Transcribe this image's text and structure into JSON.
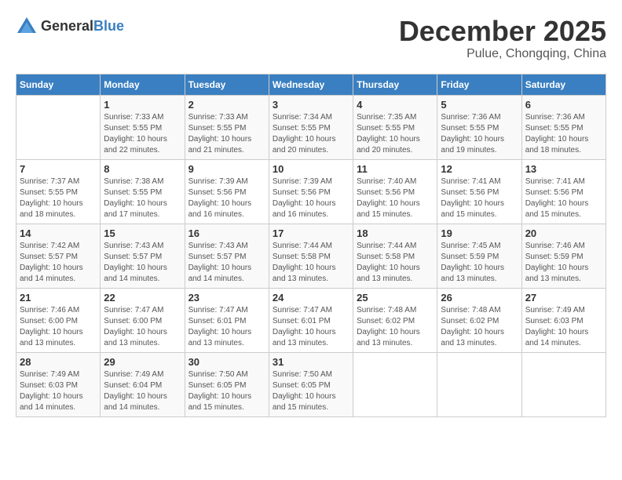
{
  "logo": {
    "general": "General",
    "blue": "Blue"
  },
  "title": "December 2025",
  "location": "Pulue, Chongqing, China",
  "days_of_week": [
    "Sunday",
    "Monday",
    "Tuesday",
    "Wednesday",
    "Thursday",
    "Friday",
    "Saturday"
  ],
  "weeks": [
    [
      {
        "day": "",
        "info": ""
      },
      {
        "day": "1",
        "info": "Sunrise: 7:33 AM\nSunset: 5:55 PM\nDaylight: 10 hours\nand 22 minutes."
      },
      {
        "day": "2",
        "info": "Sunrise: 7:33 AM\nSunset: 5:55 PM\nDaylight: 10 hours\nand 21 minutes."
      },
      {
        "day": "3",
        "info": "Sunrise: 7:34 AM\nSunset: 5:55 PM\nDaylight: 10 hours\nand 20 minutes."
      },
      {
        "day": "4",
        "info": "Sunrise: 7:35 AM\nSunset: 5:55 PM\nDaylight: 10 hours\nand 20 minutes."
      },
      {
        "day": "5",
        "info": "Sunrise: 7:36 AM\nSunset: 5:55 PM\nDaylight: 10 hours\nand 19 minutes."
      },
      {
        "day": "6",
        "info": "Sunrise: 7:36 AM\nSunset: 5:55 PM\nDaylight: 10 hours\nand 18 minutes."
      }
    ],
    [
      {
        "day": "7",
        "info": "Sunrise: 7:37 AM\nSunset: 5:55 PM\nDaylight: 10 hours\nand 18 minutes."
      },
      {
        "day": "8",
        "info": "Sunrise: 7:38 AM\nSunset: 5:55 PM\nDaylight: 10 hours\nand 17 minutes."
      },
      {
        "day": "9",
        "info": "Sunrise: 7:39 AM\nSunset: 5:56 PM\nDaylight: 10 hours\nand 16 minutes."
      },
      {
        "day": "10",
        "info": "Sunrise: 7:39 AM\nSunset: 5:56 PM\nDaylight: 10 hours\nand 16 minutes."
      },
      {
        "day": "11",
        "info": "Sunrise: 7:40 AM\nSunset: 5:56 PM\nDaylight: 10 hours\nand 15 minutes."
      },
      {
        "day": "12",
        "info": "Sunrise: 7:41 AM\nSunset: 5:56 PM\nDaylight: 10 hours\nand 15 minutes."
      },
      {
        "day": "13",
        "info": "Sunrise: 7:41 AM\nSunset: 5:56 PM\nDaylight: 10 hours\nand 15 minutes."
      }
    ],
    [
      {
        "day": "14",
        "info": "Sunrise: 7:42 AM\nSunset: 5:57 PM\nDaylight: 10 hours\nand 14 minutes."
      },
      {
        "day": "15",
        "info": "Sunrise: 7:43 AM\nSunset: 5:57 PM\nDaylight: 10 hours\nand 14 minutes."
      },
      {
        "day": "16",
        "info": "Sunrise: 7:43 AM\nSunset: 5:57 PM\nDaylight: 10 hours\nand 14 minutes."
      },
      {
        "day": "17",
        "info": "Sunrise: 7:44 AM\nSunset: 5:58 PM\nDaylight: 10 hours\nand 13 minutes."
      },
      {
        "day": "18",
        "info": "Sunrise: 7:44 AM\nSunset: 5:58 PM\nDaylight: 10 hours\nand 13 minutes."
      },
      {
        "day": "19",
        "info": "Sunrise: 7:45 AM\nSunset: 5:59 PM\nDaylight: 10 hours\nand 13 minutes."
      },
      {
        "day": "20",
        "info": "Sunrise: 7:46 AM\nSunset: 5:59 PM\nDaylight: 10 hours\nand 13 minutes."
      }
    ],
    [
      {
        "day": "21",
        "info": "Sunrise: 7:46 AM\nSunset: 6:00 PM\nDaylight: 10 hours\nand 13 minutes."
      },
      {
        "day": "22",
        "info": "Sunrise: 7:47 AM\nSunset: 6:00 PM\nDaylight: 10 hours\nand 13 minutes."
      },
      {
        "day": "23",
        "info": "Sunrise: 7:47 AM\nSunset: 6:01 PM\nDaylight: 10 hours\nand 13 minutes."
      },
      {
        "day": "24",
        "info": "Sunrise: 7:47 AM\nSunset: 6:01 PM\nDaylight: 10 hours\nand 13 minutes."
      },
      {
        "day": "25",
        "info": "Sunrise: 7:48 AM\nSunset: 6:02 PM\nDaylight: 10 hours\nand 13 minutes."
      },
      {
        "day": "26",
        "info": "Sunrise: 7:48 AM\nSunset: 6:02 PM\nDaylight: 10 hours\nand 13 minutes."
      },
      {
        "day": "27",
        "info": "Sunrise: 7:49 AM\nSunset: 6:03 PM\nDaylight: 10 hours\nand 14 minutes."
      }
    ],
    [
      {
        "day": "28",
        "info": "Sunrise: 7:49 AM\nSunset: 6:03 PM\nDaylight: 10 hours\nand 14 minutes."
      },
      {
        "day": "29",
        "info": "Sunrise: 7:49 AM\nSunset: 6:04 PM\nDaylight: 10 hours\nand 14 minutes."
      },
      {
        "day": "30",
        "info": "Sunrise: 7:50 AM\nSunset: 6:05 PM\nDaylight: 10 hours\nand 15 minutes."
      },
      {
        "day": "31",
        "info": "Sunrise: 7:50 AM\nSunset: 6:05 PM\nDaylight: 10 hours\nand 15 minutes."
      },
      {
        "day": "",
        "info": ""
      },
      {
        "day": "",
        "info": ""
      },
      {
        "day": "",
        "info": ""
      }
    ]
  ]
}
